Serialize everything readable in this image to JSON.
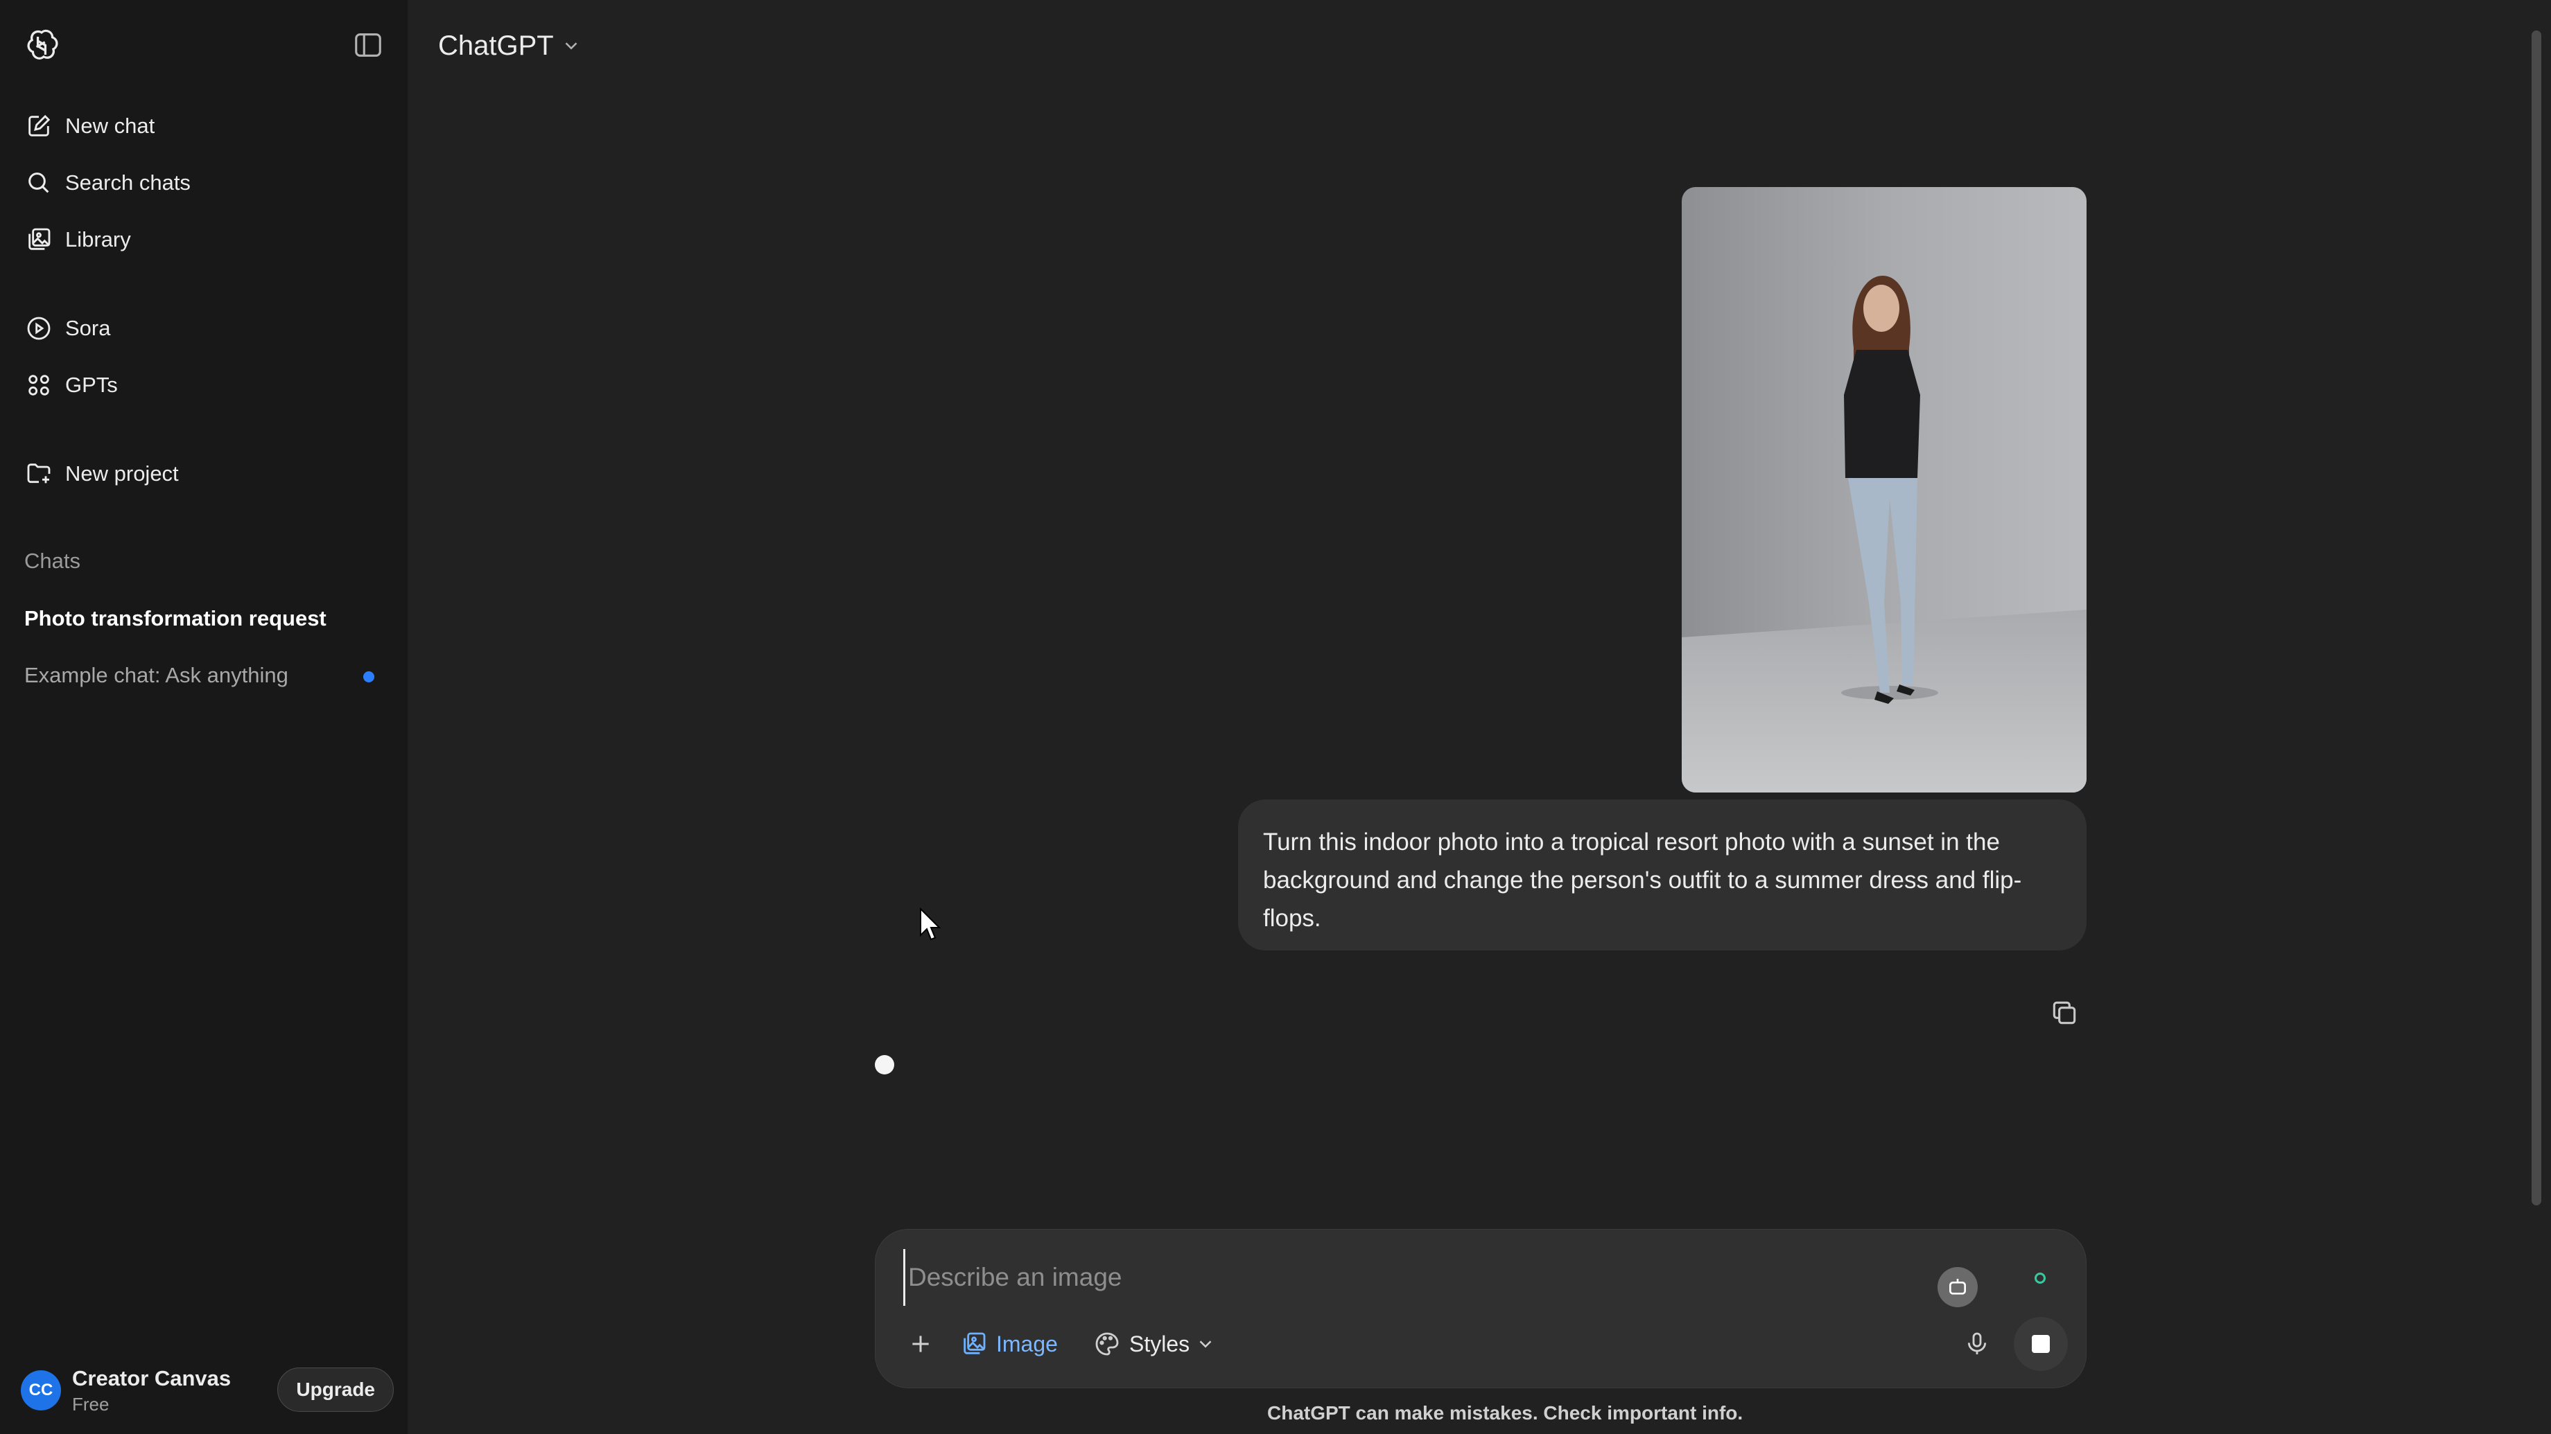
{
  "sidebar": {
    "items": [
      {
        "label": "New chat",
        "icon": "edit-icon"
      },
      {
        "label": "Search chats",
        "icon": "search-icon"
      },
      {
        "label": "Library",
        "icon": "library-icon"
      },
      {
        "label": "Sora",
        "icon": "play-icon"
      },
      {
        "label": "GPTs",
        "icon": "grid-icon"
      },
      {
        "label": "New project",
        "icon": "folder-plus-icon"
      }
    ],
    "chats_label": "Chats",
    "chats": [
      {
        "title": "Photo transformation request",
        "active": true
      },
      {
        "title": "Example chat: Ask anything",
        "unread": true
      }
    ],
    "profile": {
      "initials": "CC",
      "name": "Creator Canvas",
      "plan": "Free",
      "upgrade_label": "Upgrade"
    }
  },
  "header": {
    "model_label": "ChatGPT"
  },
  "conversation": {
    "user_message": "Turn this indoor photo into a tropical resort photo with a sunset in the background and change the person's outfit to a summer dress and flip-flops."
  },
  "composer": {
    "placeholder": "Describe an image",
    "value": "",
    "image_label": "Image",
    "styles_label": "Styles"
  },
  "footer": {
    "disclaimer": "ChatGPT can make mistakes. Check important info."
  },
  "colors": {
    "background": "#212121",
    "sidebar": "#181818",
    "bubble": "#303030",
    "accent_blue": "#2b7fff",
    "avatar": "#1e73e8"
  }
}
